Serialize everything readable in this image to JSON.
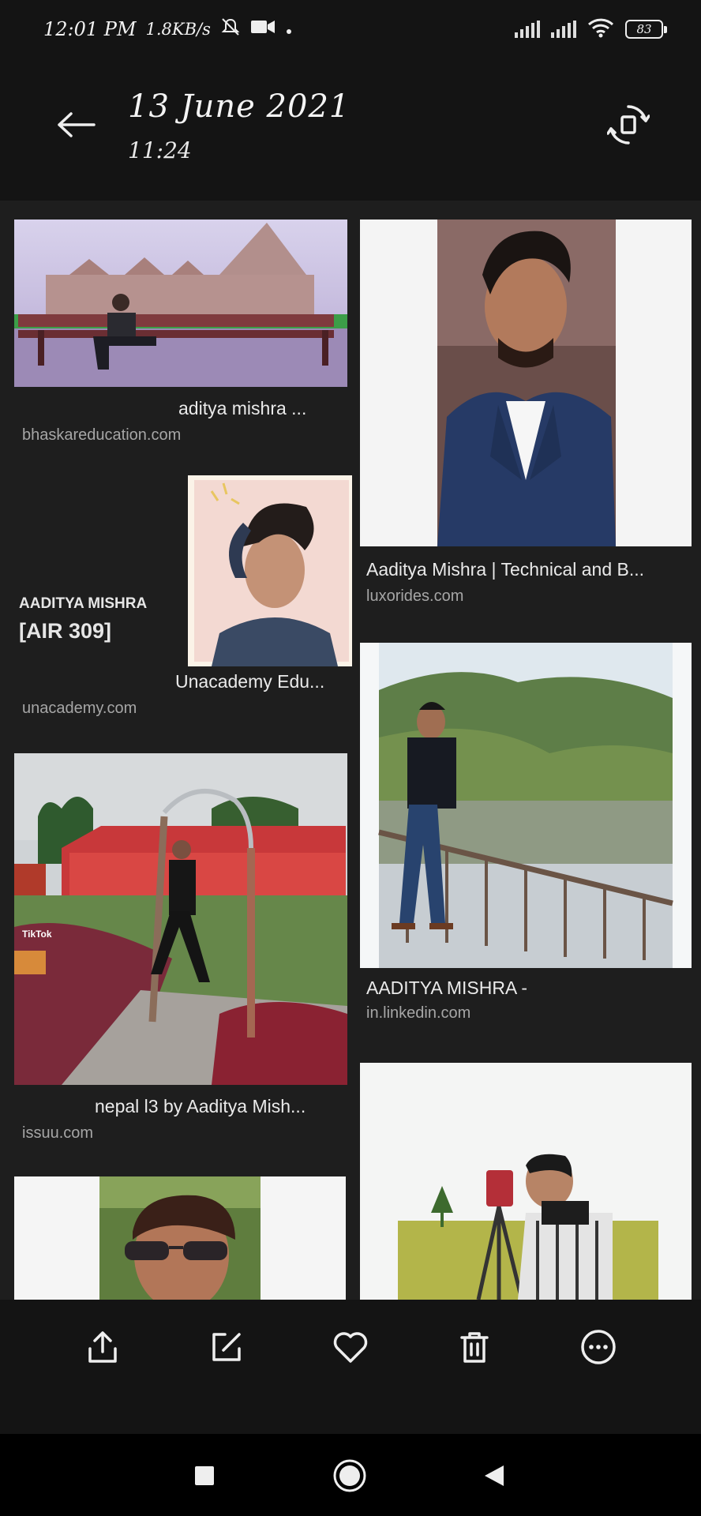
{
  "status_bar": {
    "time": "12:01 PM",
    "speed": "1.8KB/s",
    "battery": "83"
  },
  "header": {
    "date": "13 June 2021",
    "time": "11:24"
  },
  "results": [
    {
      "caption": "aditya mishra ...",
      "source": "bhaskareducation.com"
    },
    {
      "caption": "Aaditya Mishra | Technical and B...",
      "source": "luxorides.com"
    },
    {
      "caption": "Unacademy Edu...",
      "source": "unacademy.com",
      "overlay_name": "AADITYA MISHRA",
      "overlay_rank": "[AIR 309]"
    },
    {
      "caption": "AADITYA MISHRA -",
      "source": "in.linkedin.com"
    },
    {
      "caption": "nepal l3 by Aaditya Mish...",
      "source": "issuu.com",
      "watermark": "TikTok"
    }
  ],
  "toolbar": {
    "share": "share-icon",
    "edit": "edit-icon",
    "favorite": "heart-icon",
    "delete": "trash-icon",
    "more": "more-icon"
  }
}
